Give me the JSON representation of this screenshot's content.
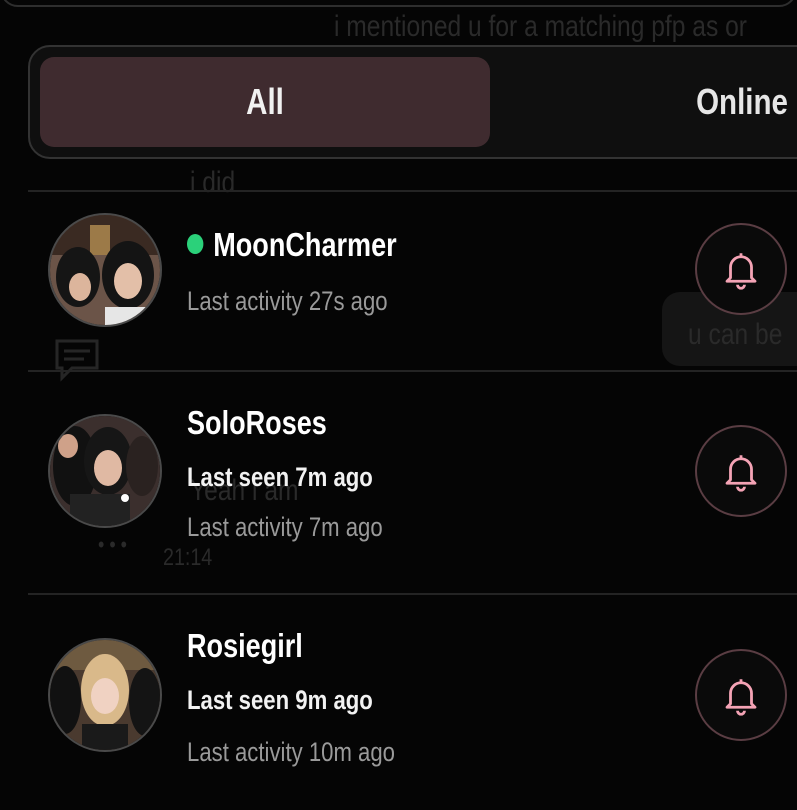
{
  "background_chat": {
    "message_top": "i mentioned u for a matching pfp as or",
    "message_did": "i did",
    "message_right": "u can be",
    "message_yeah": "Yeah i am",
    "time": "21:14",
    "dots": "• • •"
  },
  "tabs": [
    {
      "label": "All",
      "active": true
    },
    {
      "label": "Online",
      "active": false
    }
  ],
  "users": [
    {
      "name": "MoonCharmer",
      "online": true,
      "last_seen": "",
      "last_activity": "Last activity 27s ago"
    },
    {
      "name": "SoloRoses",
      "online": false,
      "last_seen": "Last seen 7m ago",
      "last_activity": "Last activity 7m ago"
    },
    {
      "name": "Rosiegirl",
      "online": false,
      "last_seen": "Last seen 9m ago",
      "last_activity": "Last activity 10m ago"
    }
  ],
  "colors": {
    "accent_pink": "#f4a3b5",
    "online_green": "#2bd17a",
    "tab_active_bg": "#3f2b2f"
  },
  "icons": {
    "bell": "bell-icon",
    "chat": "chat-icon"
  }
}
